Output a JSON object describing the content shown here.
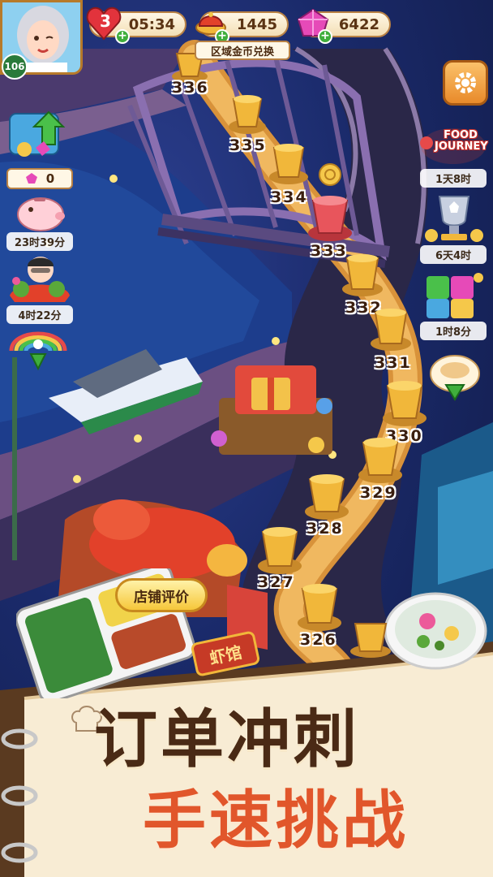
{
  "player": {
    "level": "106"
  },
  "hud": {
    "lives": "3",
    "timer": "05:34",
    "coins": "1445",
    "gems": "6422",
    "coin_exchange_label": "区域金币兑换"
  },
  "left_panel": {
    "gem_counter": "0",
    "piggy_timer": "23时39分",
    "event_timer": "4时22分"
  },
  "right_panel": {
    "food_journey_title_line1": "FOOD",
    "food_journey_title_line2": "JOURNEY",
    "food_journey_timer": "1天8时",
    "trophy_timer": "6天4时",
    "puzzle_timer": "1时8分"
  },
  "map": {
    "levels": [
      "336",
      "335",
      "334",
      "333",
      "332",
      "331",
      "330",
      "329",
      "328",
      "327",
      "326"
    ],
    "current_level": "333"
  },
  "restaurant": {
    "review_button": "店铺评价",
    "sign_text": "虾馆"
  },
  "promo": {
    "line1": "订单冲刺",
    "line2": "手速挑战"
  },
  "colors": {
    "accent_gold": "#f1b73a",
    "current_node": "#e8555c",
    "promo_dark": "#4a2a15",
    "promo_orange": "#e1562b"
  }
}
